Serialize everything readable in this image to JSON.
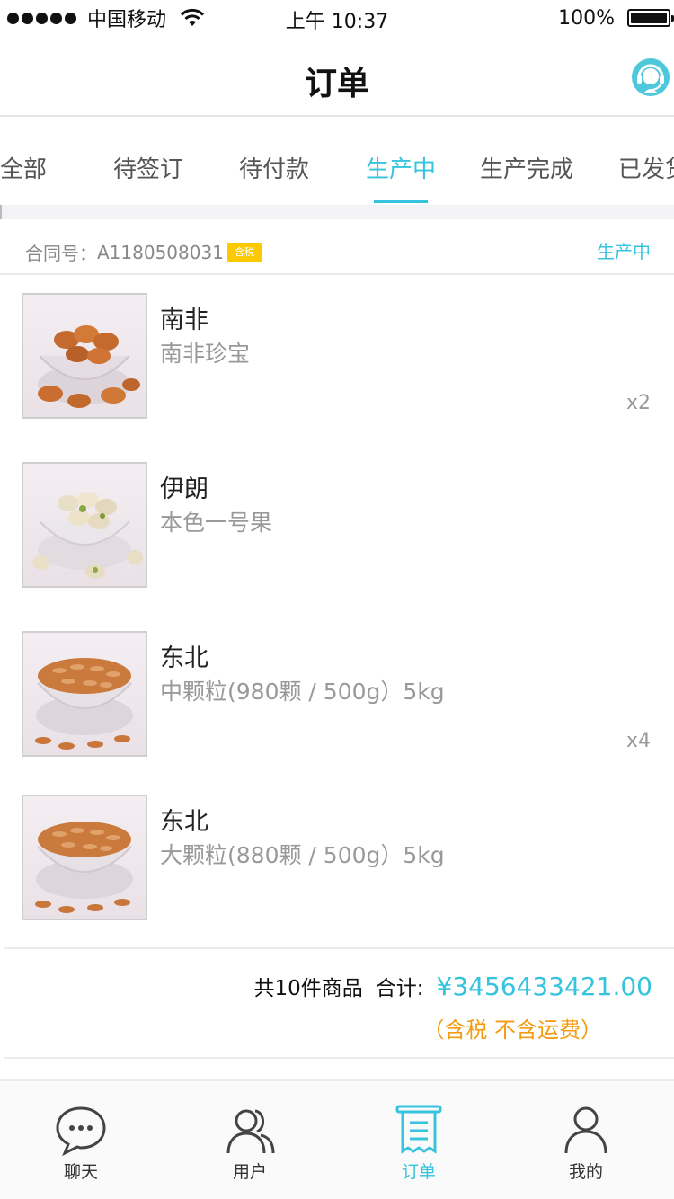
{
  "status_bar": {
    "carrier": "中国移动",
    "time": "上午 10:37",
    "battery": "100%"
  },
  "nav": {
    "title": "订单",
    "support_icon": "customer-service-icon"
  },
  "tabs": [
    {
      "label": "全部"
    },
    {
      "label": "待签订"
    },
    {
      "label": "待付款"
    },
    {
      "label": "生产中"
    },
    {
      "label": "生产完成"
    },
    {
      "label": "已发货"
    }
  ],
  "active_tab": "生产中",
  "order": {
    "contract_label": "合同号：",
    "contract_no": "A1180508031",
    "tax_badge": "含税",
    "status": "生产中",
    "items": [
      {
        "name": "南非",
        "spec": "南非珍宝",
        "qty": "x2",
        "image": "pecan-bowl"
      },
      {
        "name": "伊朗",
        "spec": "本色一号果",
        "qty": "",
        "image": "pistachio-bowl"
      },
      {
        "name": "东北",
        "spec": "中颗粒(980颗 / 500g）5kg",
        "qty": "x4",
        "image": "pine-nut-bowl"
      },
      {
        "name": "东北",
        "spec": "大颗粒(880颗 / 500g）5kg",
        "qty": "",
        "image": "pine-nut-bowl"
      }
    ],
    "count_text": "共10件商品",
    "total_label": "合计:",
    "total_amount": "¥3456433421.00",
    "tax_note": "（含税 不含运费）"
  },
  "tab_bar": [
    {
      "label": "聊天",
      "icon": "chat-bubble-icon"
    },
    {
      "label": "用户",
      "icon": "users-icon"
    },
    {
      "label": "订单",
      "icon": "receipt-icon"
    },
    {
      "label": "我的",
      "icon": "person-icon"
    }
  ],
  "colors": {
    "accent": "#36c3dd",
    "badge": "#fcc800",
    "tax_note": "#f39c12"
  }
}
